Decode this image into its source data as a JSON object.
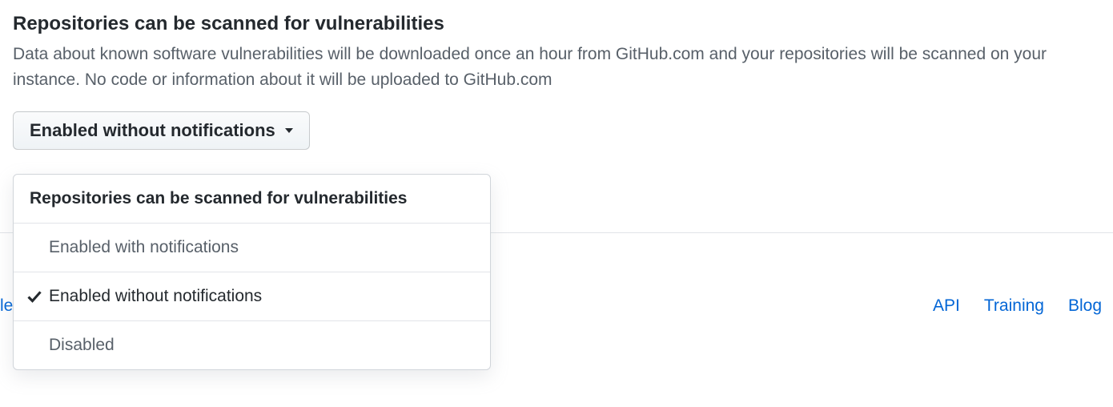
{
  "section": {
    "title": "Repositories can be scanned for vulnerabilities",
    "description": "Data about known software vulnerabilities will be downloaded once an hour from GitHub.com and your repositories will be scanned on your instance. No code or information about it will be uploaded to GitHub.com"
  },
  "dropdown": {
    "selected_label": "Enabled without notifications",
    "menu_header": "Repositories can be scanned for vulnerabilities",
    "items": [
      {
        "label": "Enabled with notifications",
        "selected": false
      },
      {
        "label": "Enabled without notifications",
        "selected": true
      },
      {
        "label": "Disabled",
        "selected": false
      }
    ]
  },
  "footer": {
    "left_fragment": "le",
    "links": [
      {
        "label": "API"
      },
      {
        "label": "Training"
      },
      {
        "label": "Blog"
      }
    ]
  }
}
